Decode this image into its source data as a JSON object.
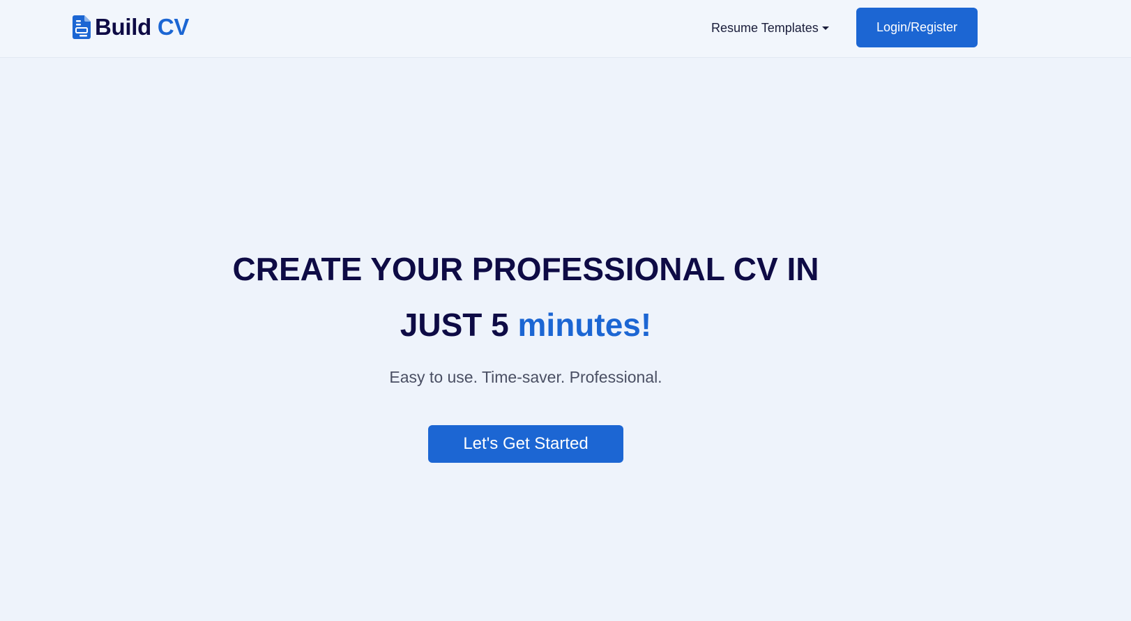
{
  "navbar": {
    "brand": {
      "icon": "document-icon",
      "text_primary": "Build",
      "text_accent": "CV"
    },
    "dropdown_label": "Resume Templates",
    "login_label": "Login/Register"
  },
  "hero": {
    "title_line1": "CREATE YOUR PROFESSIONAL CV IN",
    "title_line2_primary": "JUST 5 ",
    "title_line2_accent": "minutes!",
    "subtitle": "Easy to use. Time-saver. Professional.",
    "cta_label": "Let's Get Started"
  },
  "colors": {
    "background": "#eef3fb",
    "navy": "#0e0b45",
    "accent": "#1c66d3",
    "muted_text": "#4a4f63"
  }
}
